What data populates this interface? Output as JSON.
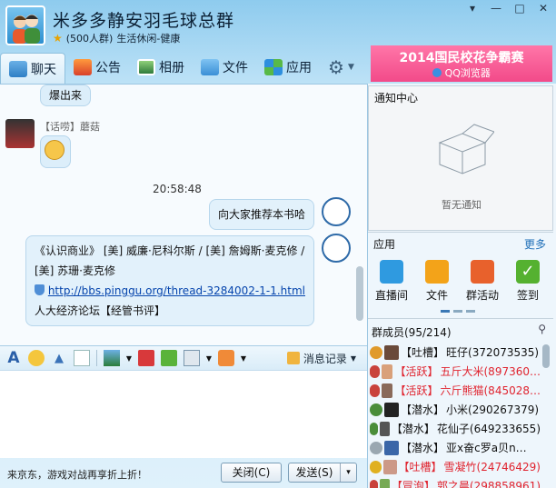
{
  "window": {
    "group_name": "米多多静安羽毛球总群",
    "member_cap": "(500人群)",
    "category": "生活休闲-健康",
    "buttons": [
      "▾",
      "—",
      "□",
      "✕"
    ]
  },
  "tabs": [
    {
      "label": "聊天",
      "icon": "chat-icon",
      "active": true
    },
    {
      "label": "公告",
      "icon": "megaphone-icon",
      "active": false
    },
    {
      "label": "相册",
      "icon": "album-icon",
      "active": false
    },
    {
      "label": "文件",
      "icon": "folder-icon",
      "active": false
    },
    {
      "label": "应用",
      "icon": "apps-icon",
      "active": false
    }
  ],
  "ad": {
    "title": "2014国民校花争霸赛",
    "subtitle": "QQ浏览器"
  },
  "chat": {
    "messages": [
      {
        "type": "text",
        "text": "爆出来"
      },
      {
        "type": "sender",
        "tag": "【话唠】",
        "name": "蘑菇"
      },
      {
        "type": "emoji",
        "icon": "emoji-icon"
      },
      {
        "type": "time",
        "text": "20:58:48"
      },
      {
        "type": "text",
        "text": "向大家推荐本书哈"
      },
      {
        "type": "rich",
        "text": "《认识商业》 [美] 威廉·尼科尔斯 / [美] 詹姆斯·麦克修 / [美] 苏珊·麦克修",
        "link": "http://bbs.pinggu.org/thread-3284002-1-1.html",
        "footer": "人大经济论坛【经管书评】"
      }
    ]
  },
  "input_toolbar": {
    "history_label": "消息记录"
  },
  "bottom": {
    "promo": "来京东，游戏对战再享折上折！",
    "close_label": "关闭(C)",
    "send_label": "发送(S)",
    "send_arrow": "▾"
  },
  "right": {
    "notice_title": "通知中心",
    "notice_empty": "暂无通知",
    "apps_title": "应用",
    "apps_more": "更多",
    "apps": [
      {
        "label": "直播间",
        "color": "#2f9ae0"
      },
      {
        "label": "文件",
        "color": "#f3a319"
      },
      {
        "label": "群活动",
        "color": "#e8612c"
      },
      {
        "label": "签到",
        "color": "#55b130"
      }
    ],
    "members_title": "群成员(95/214)",
    "members": [
      {
        "tag": "【吐槽】",
        "name": "旺仔(372073535)",
        "red": false,
        "role": "#e09a2b"
      },
      {
        "tag": "【活跃】",
        "name": "五斤大米(897360…",
        "red": true,
        "role": "#c9423b"
      },
      {
        "tag": "【活跃】",
        "name": "六斤熊猫(845028…",
        "red": true,
        "role": "#c9423b"
      },
      {
        "tag": "【潜水】",
        "name": "小米(290267379)",
        "red": false,
        "role": "#4a8d3a"
      },
      {
        "tag": "【潜水】",
        "name": "花仙子(649233655)",
        "red": false,
        "role": "#4a8d3a"
      },
      {
        "tag": "【潜水】",
        "name": "亚x奋c罗a贝n…",
        "red": false,
        "role": "#9aa7b1"
      },
      {
        "tag": "【吐槽】",
        "name": "雪凝竹(24746429)",
        "red": true,
        "role": "#e0b020"
      },
      {
        "tag": "【冒泡】",
        "name": "郭之晨(298858961)",
        "red": true,
        "role": "#c9423b"
      }
    ]
  }
}
